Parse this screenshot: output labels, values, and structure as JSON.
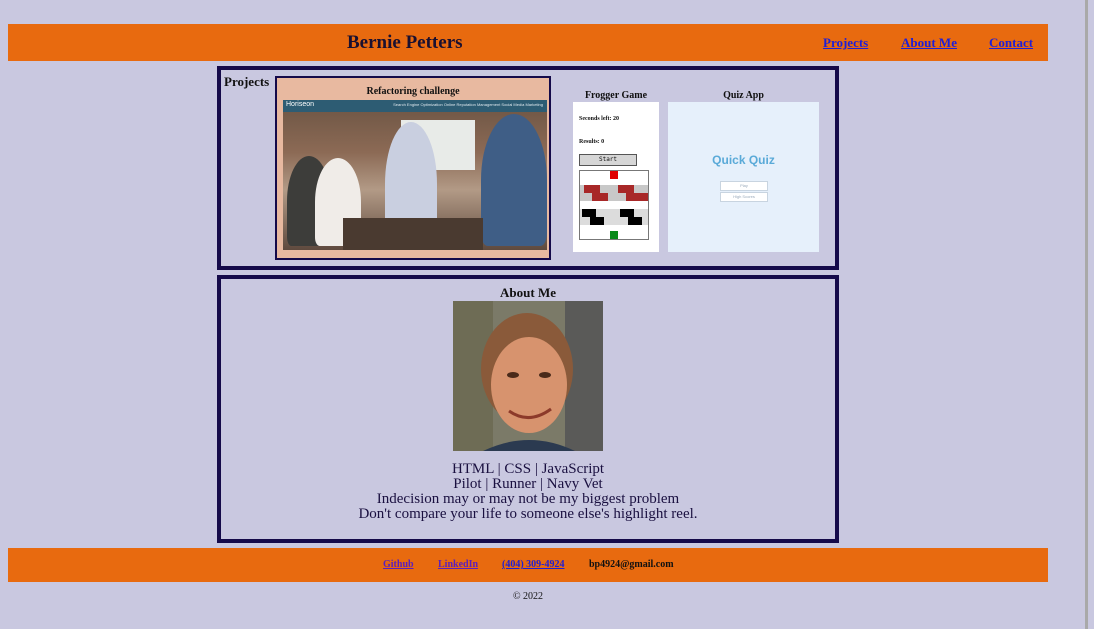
{
  "header": {
    "title": "Bernie Petters",
    "nav": [
      "Projects",
      "About Me",
      "Contact"
    ]
  },
  "projects": {
    "heading": "Projects",
    "cards": [
      {
        "title": "Refactoring challenge",
        "preview": {
          "brand": "Horiseon",
          "nav": "Search Engine Optimization   Online Reputation Management   Social Media Marketing"
        }
      },
      {
        "title": "Frogger Game",
        "preview": {
          "seconds": "Seconds left: 20",
          "results": "Results: 0",
          "button": "Start"
        }
      },
      {
        "title": "Quiz App",
        "preview": {
          "heading": "Quick Quiz",
          "buttons": [
            "Play",
            "High Scores"
          ]
        }
      }
    ]
  },
  "about": {
    "heading": "About Me",
    "lines": [
      "HTML | CSS | JavaScript",
      "Pilot | Runner | Navy Vet",
      "Indecision may or may not be my biggest problem",
      "Don't compare your life to someone else's highlight reel."
    ]
  },
  "footer": {
    "links": [
      "Github",
      "LinkedIn",
      "(404) 309-4924"
    ],
    "email": "bp4924@gmail.com",
    "copyright": "© 2022"
  },
  "colors": {
    "background": "#c9c8e0",
    "header": "#e86a0f",
    "border": "#150a4a",
    "link": "#1f1fd6"
  }
}
